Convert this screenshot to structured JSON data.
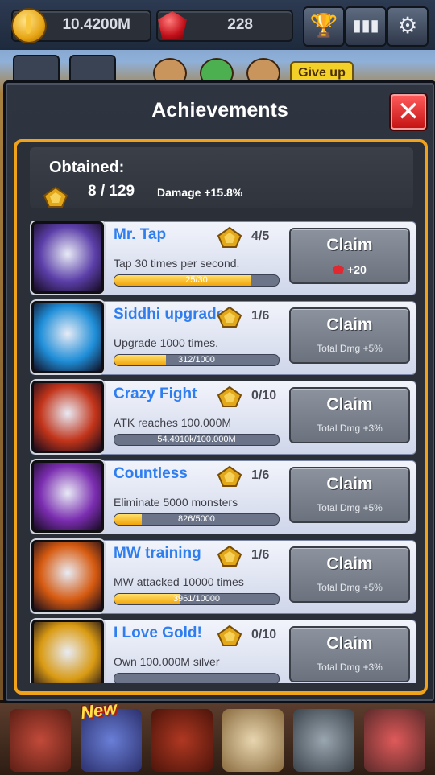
{
  "topbar": {
    "gold": "10.4200M",
    "gems": "228",
    "icons": [
      "trophy-icon",
      "leaderboard-icon",
      "gear-icon"
    ]
  },
  "giveup_label": "Give up",
  "dialog": {
    "title": "Achievements",
    "close_icon": "close-icon",
    "summary": {
      "obtained_label": "Obtained:",
      "count": "8 / 129",
      "damage": "Damage +15.8%"
    },
    "achievements": [
      {
        "name": "Mr. Tap",
        "progress": "4/5",
        "desc": "Tap 30 times per second.",
        "bar_text": "25/30",
        "fill": 0.833,
        "claim": "Claim",
        "reward": "+20",
        "reward_gem": true,
        "icon": "tap-icon",
        "color": "#5b3ea8"
      },
      {
        "name": "Siddhi upgrade",
        "progress": "1/6",
        "desc": "Upgrade 1000 times.",
        "bar_text": "312/1000",
        "fill": 0.312,
        "claim": "Claim",
        "reward": "Total Dmg +5%",
        "reward_gem": false,
        "icon": "upgrade-chest-icon",
        "color": "#1f8ed8"
      },
      {
        "name": "Crazy Fight",
        "progress": "0/10",
        "desc": "ATK reaches 100.000M",
        "bar_text": "54.4910k/100.000M",
        "fill": 0.0005,
        "claim": "Claim",
        "reward": "Total Dmg +3%",
        "reward_gem": false,
        "icon": "fighter-icon",
        "color": "#c2341a"
      },
      {
        "name": "Countless",
        "progress": "1/6",
        "desc": "Eliminate 5000 monsters",
        "bar_text": "826/5000",
        "fill": 0.165,
        "claim": "Claim",
        "reward": "Total Dmg +5%",
        "reward_gem": false,
        "icon": "zombie-hand-icon",
        "color": "#7b2db0"
      },
      {
        "name": "MW training",
        "progress": "1/6",
        "desc": "MW attacked 10000 times",
        "bar_text": "3961/10000",
        "fill": 0.396,
        "claim": "Claim",
        "reward": "Total Dmg +5%",
        "reward_gem": false,
        "icon": "monster-mouth-icon",
        "color": "#d65a10"
      },
      {
        "name": "I Love Gold!",
        "progress": "0/10",
        "desc": "Own 100.000M silver",
        "bar_text": "",
        "fill": 0,
        "claim": "Claim",
        "reward": "Total Dmg +3%",
        "reward_gem": false,
        "icon": "gold-bag-icon",
        "color": "#d99a12"
      }
    ]
  },
  "bottomnav": {
    "new_tag": "New",
    "items": [
      "hero-dragon-icon",
      "hero-boy-icon",
      "spellbook-icon",
      "map-scroll-icon",
      "knight-icon",
      "shop-icon"
    ]
  }
}
